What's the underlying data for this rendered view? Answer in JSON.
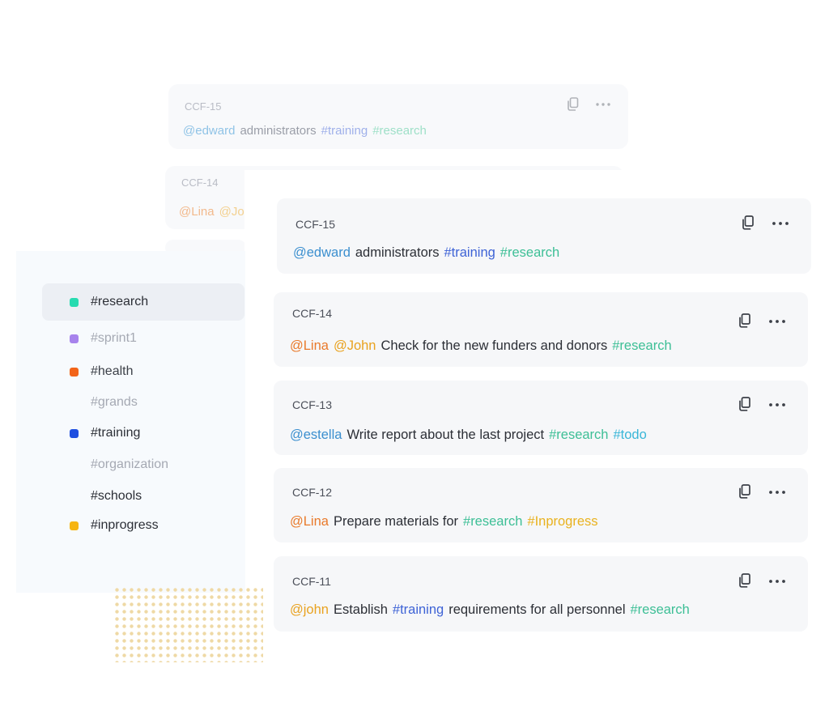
{
  "ghost_cards": [
    {
      "id": "CCF-15",
      "tokens": [
        {
          "text": "@edward",
          "color": "#8fc3e6"
        },
        {
          "text": "administrators",
          "color": "#9a9ea8"
        },
        {
          "text": "#training",
          "color": "#9fb0ea"
        },
        {
          "text": "#research",
          "color": "#9fe0c8"
        }
      ]
    },
    {
      "id": "CCF-14",
      "tokens": [
        {
          "text": "@Lina",
          "color": "#f2b98c"
        },
        {
          "text": "@Joh",
          "color": "#f3d08f"
        }
      ]
    }
  ],
  "sidebar": {
    "items": [
      {
        "label": "#research",
        "dot_color": "#27dbb0",
        "text_color": "#2c2f36",
        "active": true
      },
      {
        "label": "#sprint1",
        "dot_color": "#a783ec",
        "text_color": "#a5a9b3",
        "active": false
      },
      {
        "label": "#health",
        "dot_color": "#f26419",
        "text_color": "#3c4048",
        "active": false
      },
      {
        "label": "#grands",
        "dot_color": null,
        "text_color": "#a5a9b3",
        "active": false
      },
      {
        "label": "#training",
        "dot_color": "#1f4fe0",
        "text_color": "#2c2f36",
        "active": false
      },
      {
        "label": "#organization",
        "dot_color": null,
        "text_color": "#a5a9b3",
        "active": false
      },
      {
        "label": "#schools",
        "dot_color": null,
        "text_color": "#2c2f36",
        "active": false
      },
      {
        "label": "#inprogress",
        "dot_color": "#f6b512",
        "text_color": "#2c2f36",
        "active": false
      }
    ]
  },
  "cards": [
    {
      "id": "CCF-15",
      "tokens": [
        {
          "text": "@edward",
          "kind": "mention-blue"
        },
        {
          "text": "administrators",
          "kind": "txt"
        },
        {
          "text": "#training",
          "kind": "tag-blue"
        },
        {
          "text": "#research",
          "kind": "tag-green"
        }
      ]
    },
    {
      "id": "CCF-14",
      "tokens": [
        {
          "text": "@Lina",
          "kind": "mention-orange"
        },
        {
          "text": "@John",
          "kind": "mention-yellow"
        },
        {
          "text": "Check for the new funders and donors",
          "kind": "txt"
        },
        {
          "text": "#research",
          "kind": "tag-green"
        }
      ]
    },
    {
      "id": "CCF-13",
      "tokens": [
        {
          "text": "@estella",
          "kind": "mention-blue"
        },
        {
          "text": "Write report about the last project",
          "kind": "txt"
        },
        {
          "text": "#research",
          "kind": "tag-green"
        },
        {
          "text": "#todo",
          "kind": "tag-cyan"
        }
      ]
    },
    {
      "id": "CCF-12",
      "tokens": [
        {
          "text": "@Lina",
          "kind": "mention-orange"
        },
        {
          "text": "Prepare materials for",
          "kind": "txt"
        },
        {
          "text": "#research",
          "kind": "tag-green"
        },
        {
          "text": "#Inprogress",
          "kind": "tag-yellow"
        }
      ]
    },
    {
      "id": "CCF-11",
      "tokens": [
        {
          "text": "@john",
          "kind": "mention-yellow"
        },
        {
          "text": "Establish",
          "kind": "txt"
        },
        {
          "text": "#training",
          "kind": "tag-blue"
        },
        {
          "text": "requirements for all personnel",
          "kind": "txt"
        },
        {
          "text": "#research",
          "kind": "tag-green"
        }
      ]
    }
  ],
  "icons": {
    "copy": "copy-icon",
    "more": "more-icon"
  }
}
